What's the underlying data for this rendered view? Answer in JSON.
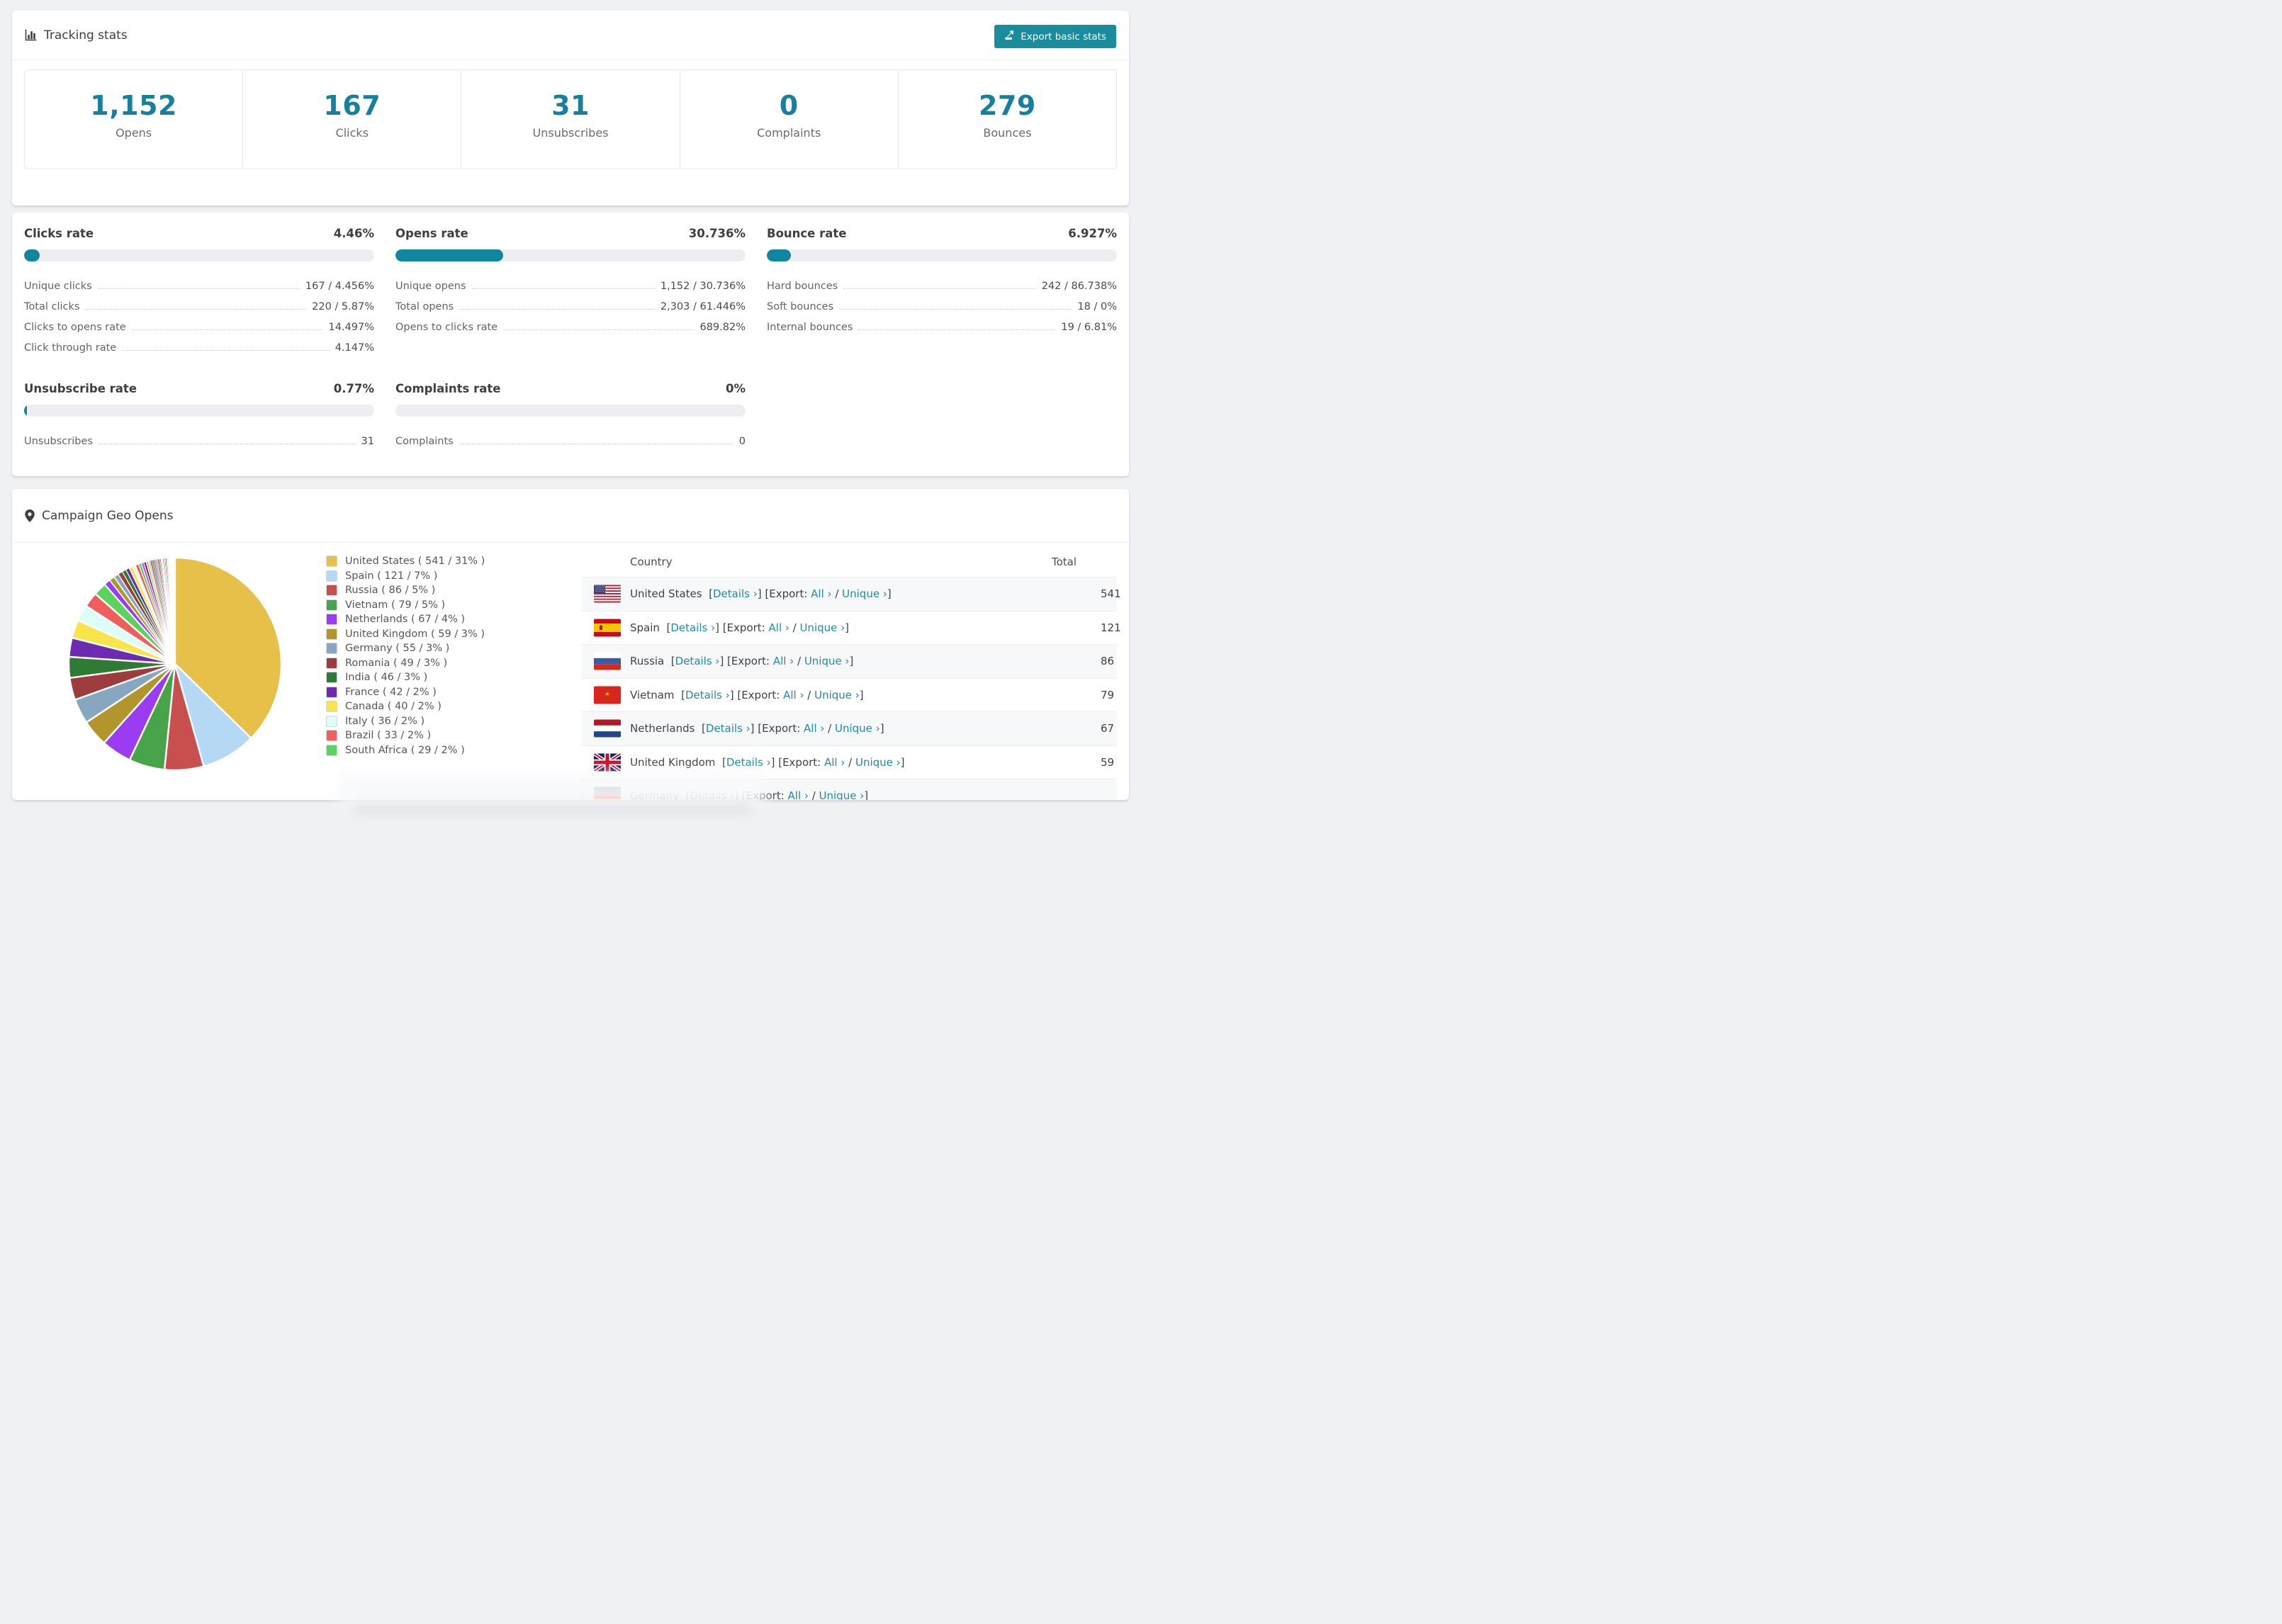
{
  "accent": "#17809e",
  "button_color": "#1a8c9e",
  "link_color": "#228aa6",
  "bar_fill_color": "#1186a0",
  "header": {
    "title": "Tracking stats",
    "export_label": "Export basic stats"
  },
  "summary_stats": [
    {
      "value": "1,152",
      "label": "Opens"
    },
    {
      "value": "167",
      "label": "Clicks"
    },
    {
      "value": "31",
      "label": "Unsubscribes"
    },
    {
      "value": "0",
      "label": "Complaints"
    },
    {
      "value": "279",
      "label": "Bounces"
    }
  ],
  "rates": [
    {
      "title": "Clicks rate",
      "value": "4.46%",
      "percent": 4.46,
      "rows": [
        {
          "label": "Unique clicks",
          "value": "167 / 4.456%"
        },
        {
          "label": "Total clicks",
          "value": "220 / 5.87%"
        },
        {
          "label": "Clicks to opens rate",
          "value": "14.497%"
        },
        {
          "label": "Click through rate",
          "value": "4.147%"
        }
      ]
    },
    {
      "title": "Opens rate",
      "value": "30.736%",
      "percent": 30.736,
      "rows": [
        {
          "label": "Unique opens",
          "value": "1,152 / 30.736%"
        },
        {
          "label": "Total opens",
          "value": "2,303 / 61.446%"
        },
        {
          "label": "Opens to clicks rate",
          "value": "689.82%"
        }
      ]
    },
    {
      "title": "Bounce rate",
      "value": "6.927%",
      "percent": 6.927,
      "rows": [
        {
          "label": "Hard bounces",
          "value": "242 / 86.738%"
        },
        {
          "label": "Soft bounces",
          "value": "18 / 0%"
        },
        {
          "label": "Internal bounces",
          "value": "19 / 6.81%"
        }
      ]
    },
    {
      "title": "Unsubscribe rate",
      "value": "0.77%",
      "percent": 0.77,
      "rows": [
        {
          "label": "Unsubscribes",
          "value": "31"
        }
      ]
    },
    {
      "title": "Complaints rate",
      "value": "0%",
      "percent": 0,
      "rows": [
        {
          "label": "Complaints",
          "value": "0"
        }
      ]
    }
  ],
  "geo": {
    "title": "Campaign Geo Opens",
    "strings": {
      "bracket_open": "[",
      "bracket_close": "]",
      "paren_open": "(",
      "paren_close": ")",
      "slash": "/",
      "export_label": "Export:",
      "details_label": "Details ›",
      "all_label": "All ›",
      "unique_label": "Unique ›"
    },
    "table": {
      "columns": [
        "Country",
        "Total"
      ],
      "rows": [
        {
          "country": "United States",
          "flag": "us",
          "total": "541",
          "partial": false
        },
        {
          "country": "Spain",
          "flag": "es",
          "total": "121",
          "partial": false
        },
        {
          "country": "Russia",
          "flag": "ru",
          "total": "86",
          "partial": false
        },
        {
          "country": "Vietnam",
          "flag": "vn",
          "total": "79",
          "partial": false
        },
        {
          "country": "Netherlands",
          "flag": "nl",
          "total": "67",
          "partial": false
        },
        {
          "country": "United Kingdom",
          "flag": "gb",
          "total": "59",
          "partial": false
        },
        {
          "country": "Germany",
          "flag": "de",
          "total": "",
          "partial": true
        }
      ]
    }
  },
  "chart_data": {
    "type": "pie",
    "title": "Campaign Geo Opens",
    "legend_position": "right",
    "start_angle_deg": 0,
    "direction": "clockwise",
    "series": [
      {
        "name": "United States",
        "value": 541,
        "pct": "31%",
        "color": "#e7c04a"
      },
      {
        "name": "Spain",
        "value": 121,
        "pct": "7%",
        "color": "#b5d9f5"
      },
      {
        "name": "Russia",
        "value": 86,
        "pct": "5%",
        "color": "#c7504f"
      },
      {
        "name": "Vietnam",
        "value": 79,
        "pct": "5%",
        "color": "#47a44b"
      },
      {
        "name": "Netherlands",
        "value": 67,
        "pct": "4%",
        "color": "#9b3bf2"
      },
      {
        "name": "United Kingdom",
        "value": 59,
        "pct": "3%",
        "color": "#b2962c"
      },
      {
        "name": "Germany",
        "value": 55,
        "pct": "3%",
        "color": "#87a7c0"
      },
      {
        "name": "Romania",
        "value": 49,
        "pct": "3%",
        "color": "#9d3c3c"
      },
      {
        "name": "India",
        "value": 46,
        "pct": "3%",
        "color": "#2f7b35"
      },
      {
        "name": "France",
        "value": 42,
        "pct": "2%",
        "color": "#6c2bb0"
      },
      {
        "name": "Canada",
        "value": 40,
        "pct": "2%",
        "color": "#f8e44b"
      },
      {
        "name": "Italy",
        "value": 36,
        "pct": "2%",
        "color": "#dcfdf8"
      },
      {
        "name": "Brazil",
        "value": 33,
        "pct": "2%",
        "color": "#f15e5e"
      },
      {
        "name": "South Africa",
        "value": 29,
        "pct": "2%",
        "color": "#5bd35e"
      }
    ],
    "others_unlabeled_tail": {
      "note": "many small unlabeled slices visible in pie",
      "values": [
        14,
        12,
        11,
        10,
        9,
        8,
        8,
        7,
        7,
        6,
        6,
        5,
        5,
        4,
        4,
        4,
        3,
        3,
        3,
        3,
        2,
        2,
        2,
        2,
        2,
        2,
        2,
        2,
        2,
        2,
        1,
        1,
        1,
        1,
        1,
        1,
        1,
        1,
        1,
        1,
        1,
        1,
        1,
        1,
        1
      ],
      "palette_cycle": [
        "#e7c04a",
        "#b5d9f5",
        "#c7504f",
        "#47a44b",
        "#9b3bf2",
        "#b2962c",
        "#87a7c0",
        "#9d3c3c",
        "#2f7b35",
        "#6c2bb0",
        "#f8e44b",
        "#dcfdf8",
        "#f15e5e",
        "#5bd35e",
        "#e94ae0",
        "#2c2c6e"
      ],
      "palette_start_index": 4
    }
  }
}
